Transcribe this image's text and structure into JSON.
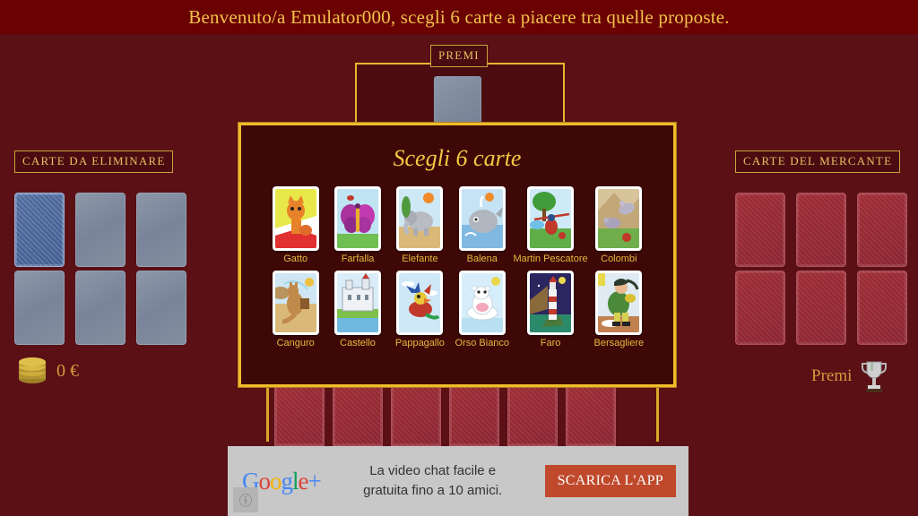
{
  "header": {
    "title": "Benvenuto/a Emulator000, scegli 6 carte a piacere tra quelle proposte."
  },
  "premi_panel": {
    "label": "PREMI"
  },
  "left_panel": {
    "label": "CARTE DA ELIMINARE",
    "slot_count": 6
  },
  "right_panel": {
    "label": "CARTE DEL MERCANTE",
    "slot_count": 6
  },
  "money": {
    "amount": "0 €",
    "icon": "coins-icon"
  },
  "trophy": {
    "label": "Premi",
    "icon": "trophy-icon"
  },
  "dialog": {
    "title": "Scegli 6 carte",
    "cards": [
      {
        "label": "Gatto",
        "bg": "#e8e84a"
      },
      {
        "label": "Farfalla",
        "bg": "#bfe4f4"
      },
      {
        "label": "Elefante",
        "bg": "#cfe8f6"
      },
      {
        "label": "Balena",
        "bg": "#c6e3f5"
      },
      {
        "label": "Martin Pescatore",
        "bg": "#cfeaf7"
      },
      {
        "label": "Colombi",
        "bg": "#d8c49a"
      },
      {
        "label": "Canguro",
        "bg": "#cfe6f4"
      },
      {
        "label": "Castello",
        "bg": "#d9ecf7"
      },
      {
        "label": "Pappagallo",
        "bg": "#cfe8f8"
      },
      {
        "label": "Orso Bianco",
        "bg": "#d6eefb"
      },
      {
        "label": "Faro",
        "bg": "#2b2560"
      },
      {
        "label": "Bersagliere",
        "bg": "#dfeaf2"
      }
    ]
  },
  "hand": {
    "card_count": 6
  },
  "ad": {
    "logo": "Google+",
    "text_line1": "La video chat facile e",
    "text_line2": "gratuita fino a 10 amici.",
    "cta": "SCARICA L'APP",
    "info_icon": "info-icon"
  },
  "colors": {
    "background": "#5a1015",
    "header_bg": "#6b0202",
    "gold": "#f0bc2c",
    "dialog_bg": "#3d0806",
    "label_gold": "#e8b93f"
  }
}
